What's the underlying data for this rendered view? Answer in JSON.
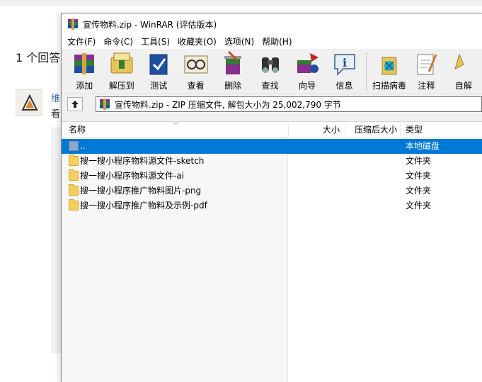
{
  "background": {
    "answer_count": "1 个回答",
    "user_name": "维",
    "snippet": "看"
  },
  "window": {
    "title": "宣传物料.zip - WinRAR (评估版本)",
    "menu": [
      "文件(F)",
      "命令(C)",
      "工具(S)",
      "收藏夹(O)",
      "选项(N)",
      "帮助(H)"
    ],
    "toolbar": [
      {
        "label": "添加",
        "icon": "add-archive-icon"
      },
      {
        "label": "解压到",
        "icon": "extract-to-icon"
      },
      {
        "label": "测试",
        "icon": "test-icon"
      },
      {
        "label": "查看",
        "icon": "view-icon"
      },
      {
        "label": "删除",
        "icon": "delete-icon"
      },
      {
        "label": "查找",
        "icon": "find-icon"
      },
      {
        "label": "向导",
        "icon": "wizard-icon"
      },
      {
        "label": "信息",
        "icon": "info-icon"
      },
      {
        "label": "扫描病毒",
        "icon": "virus-scan-icon"
      },
      {
        "label": "注释",
        "icon": "comment-icon"
      },
      {
        "label": "自解",
        "icon": "sfx-icon"
      }
    ],
    "address": "宣传物料.zip - ZIP 压缩文件, 解包大小为 25,002,790 字节",
    "columns": {
      "name": "名称",
      "size": "大小",
      "packed": "压缩后大小",
      "type": "类型"
    },
    "rows": [
      {
        "name": "..",
        "type": "本地磁盘",
        "selected": true
      },
      {
        "name": "搜一搜小程序物料源文件-sketch",
        "type": "文件夹"
      },
      {
        "name": "搜一搜小程序物料源文件-ai",
        "type": "文件夹"
      },
      {
        "name": "搜一搜小程序推广物料图片-png",
        "type": "文件夹"
      },
      {
        "name": "搜一搜小程序推广物料及示例-pdf",
        "type": "文件夹"
      }
    ]
  },
  "colors": {
    "selection": "#0078d7",
    "folder": "#f6cf5b"
  }
}
